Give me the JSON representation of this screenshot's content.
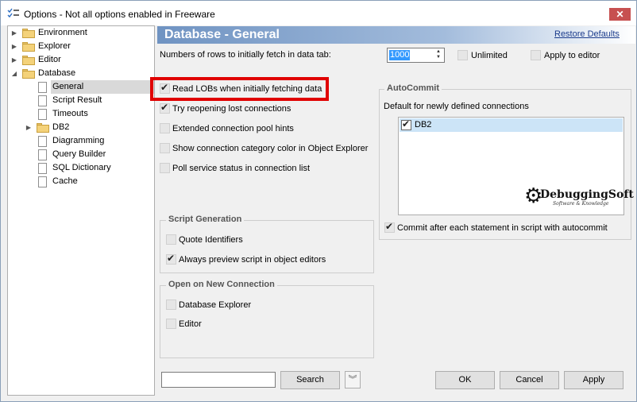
{
  "window": {
    "title": "Options - Not all options enabled in Freeware",
    "close_glyph": "✕"
  },
  "tree": {
    "items": [
      {
        "label": "Environment",
        "type": "folder",
        "expandable": true
      },
      {
        "label": "Explorer",
        "type": "folder",
        "expandable": true
      },
      {
        "label": "Editor",
        "type": "folder",
        "expandable": true
      },
      {
        "label": "Database",
        "type": "folder",
        "expanded": true
      },
      {
        "label": "General",
        "type": "doc",
        "selected": true
      },
      {
        "label": "Script Result",
        "type": "doc"
      },
      {
        "label": "Timeouts",
        "type": "doc"
      },
      {
        "label": "DB2",
        "type": "folder",
        "expandable": true
      },
      {
        "label": "Diagramming",
        "type": "doc"
      },
      {
        "label": "Query Builder",
        "type": "doc"
      },
      {
        "label": "SQL Dictionary",
        "type": "doc"
      },
      {
        "label": "Cache",
        "type": "doc"
      }
    ]
  },
  "header": {
    "title": "Database - General",
    "restore_link": "Restore Defaults"
  },
  "fetch": {
    "label": "Numbers of rows to initially fetch in data tab:",
    "value": "1000",
    "unlimited_label": "Unlimited",
    "unlimited_checked": false,
    "apply_editor_label": "Apply to editor",
    "apply_editor_checked": false
  },
  "options": [
    {
      "label": "Read LOBs when initially fetching data",
      "checked": true
    },
    {
      "label": "Try reopening lost connections",
      "checked": true
    },
    {
      "label": "Extended connection pool hints",
      "checked": false
    },
    {
      "label": "Show connection category color in Object Explorer",
      "checked": false
    },
    {
      "label": "Poll service status in connection list",
      "checked": false
    }
  ],
  "script_generation": {
    "title": "Script Generation",
    "options": [
      {
        "label": "Quote Identifiers",
        "checked": false
      },
      {
        "label": "Always preview script in object editors",
        "checked": true
      }
    ]
  },
  "open_connection": {
    "title": "Open on New Connection",
    "options": [
      {
        "label": "Database Explorer",
        "checked": false
      },
      {
        "label": "Editor",
        "checked": false
      }
    ]
  },
  "autocommit": {
    "title": "AutoCommit",
    "default_label": "Default for newly defined connections",
    "connections": [
      {
        "label": "DB2",
        "checked": true
      }
    ],
    "commit_each_label": "Commit after each statement in script with autocommit",
    "commit_each_checked": true
  },
  "logo": {
    "text": "DebuggingSoft",
    "subtitle": "Software & Knowledge"
  },
  "bottom": {
    "search_value": "",
    "search_button": "Search",
    "dropdown_glyph": "︾",
    "ok": "OK",
    "cancel": "Cancel",
    "apply": "Apply"
  },
  "colors": {
    "header_start": "#6f93c2",
    "highlight": "#e00000",
    "selection": "#cce4f7",
    "close_button": "#c75050"
  }
}
